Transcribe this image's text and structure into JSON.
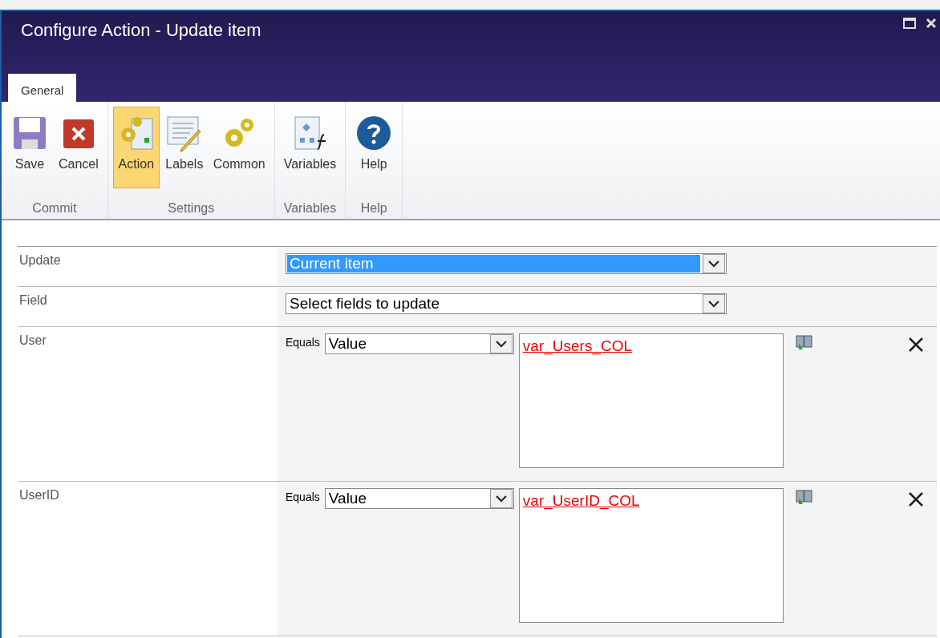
{
  "window": {
    "title": "Configure Action - Update item"
  },
  "tabs": [
    {
      "label": "General",
      "selected": true
    }
  ],
  "ribbon": [
    {
      "label": "Commit",
      "buttons": [
        {
          "kind": "save",
          "label": "Save",
          "selected": false
        },
        {
          "kind": "cancel",
          "label": "Cancel",
          "selected": false
        }
      ]
    },
    {
      "label": "Settings",
      "buttons": [
        {
          "kind": "action",
          "label": "Action",
          "selected": true
        },
        {
          "kind": "labels",
          "label": "Labels",
          "selected": false
        },
        {
          "kind": "common",
          "label": "Common",
          "selected": false
        }
      ]
    },
    {
      "label": "Variables",
      "buttons": [
        {
          "kind": "variables",
          "label": "Variables",
          "selected": false
        }
      ]
    },
    {
      "label": "Help",
      "buttons": [
        {
          "kind": "help",
          "label": "Help",
          "selected": false
        }
      ]
    }
  ],
  "form": [
    {
      "kind": "select",
      "label": "Update",
      "value": "Current item",
      "highlighted": true
    },
    {
      "kind": "select",
      "label": "Field",
      "value": "Select fields to update",
      "highlighted": false
    },
    {
      "kind": "assignment",
      "label": "User",
      "operator": "Equals",
      "source": "Value",
      "expression": "var_Users_COL"
    },
    {
      "kind": "assignment",
      "label": "UserID",
      "operator": "Equals",
      "source": "Value",
      "expression": "var_UserID_COL"
    }
  ]
}
